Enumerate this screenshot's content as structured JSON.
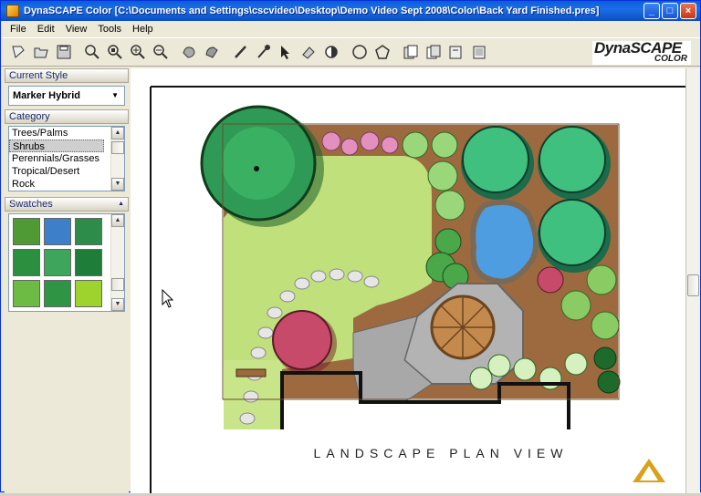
{
  "window": {
    "title": "DynaSCAPE Color [C:\\Documents and Settings\\cscvideo\\Desktop\\Demo Video Sept 2008\\Color\\Back Yard Finished.pres]",
    "controls": [
      "_",
      "□",
      "×"
    ]
  },
  "menu": [
    "File",
    "Edit",
    "View",
    "Tools",
    "Help"
  ],
  "logo": {
    "top": "DynaSCAPE",
    "sub": "COLOR"
  },
  "panels": {
    "current_style": {
      "title": "Current Style",
      "value": "Marker Hybrid"
    },
    "category": {
      "title": "Category",
      "items": [
        "Trees/Palms",
        "Shrubs",
        "Perennials/Grasses",
        "Tropical/Desert",
        "Rock"
      ],
      "selected": "Shrubs"
    },
    "swatches": {
      "title": "Swatches",
      "colors": [
        "#4f9a35",
        "#3e7fc9",
        "#2e8c4a",
        "#2a8f3e",
        "#3ea55c",
        "#1f7d3a",
        "#6dba45",
        "#2f9544",
        "#9ed22d"
      ]
    }
  },
  "canvas": {
    "caption": "LANDSCAPE PLAN VIEW"
  },
  "colors": {
    "lawn": "#bfe07a",
    "tree": "#2e9a55",
    "path": "#b3b3b3",
    "water": "#4d9de0",
    "mulch": "#9c6a3e"
  }
}
